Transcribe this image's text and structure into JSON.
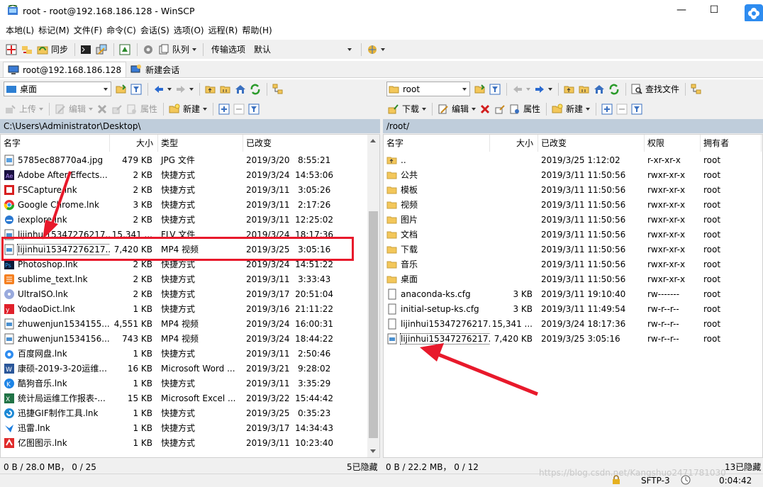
{
  "window": {
    "title": "root - root@192.168.186.128 - WinSCP"
  },
  "menu": [
    "本地(L)",
    "标记(M)",
    "文件(F)",
    "命令(C)",
    "会话(S)",
    "选项(O)",
    "远程(R)",
    "帮助(H)"
  ],
  "toolbar": {
    "sync_label": "同步",
    "queue_label": "队列",
    "transfer_label": "传输选项",
    "transfer_value": "默认"
  },
  "tabs": [
    {
      "label": "root@192.168.186.128"
    },
    {
      "label": "新建会话"
    }
  ],
  "left": {
    "location": "桌面",
    "upload_label": "上传",
    "edit_label": "编辑",
    "props_label": "属性",
    "new_label": "新建",
    "path": "C:\\Users\\Administrator\\Desktop\\",
    "columns": [
      "名字",
      "大小",
      "类型",
      "已改变"
    ],
    "files": [
      {
        "name": "5785ec88770a4.jpg",
        "size": "479 KB",
        "type": "JPG 文件",
        "changed": "2019/3/20   8:55:21",
        "icon": "image-file-icon"
      },
      {
        "name": "Adobe After Effects...",
        "size": "2 KB",
        "type": "快捷方式",
        "changed": "2019/3/24  14:53:06",
        "icon": "after-effects-icon"
      },
      {
        "name": "FSCapture.lnk",
        "size": "2 KB",
        "type": "快捷方式",
        "changed": "2019/3/11   3:05:26",
        "icon": "fscapture-icon"
      },
      {
        "name": "Google Chrome.lnk",
        "size": "3 KB",
        "type": "快捷方式",
        "changed": "2019/3/11   2:17:26",
        "icon": "chrome-icon"
      },
      {
        "name": "iexplore.lnk",
        "size": "2 KB",
        "type": "快捷方式",
        "changed": "2019/3/11  12:25:02",
        "icon": "ie-icon"
      },
      {
        "name": "lijinhui15347276217...",
        "size": "15,341 ...",
        "type": "FLV 文件",
        "changed": "2019/3/24  18:17:36",
        "icon": "video-file-icon"
      },
      {
        "name": "lijinhui15347276217...",
        "size": "7,420 KB",
        "type": "MP4 视频",
        "changed": "2019/3/25   3:05:16",
        "icon": "video-file-icon"
      },
      {
        "name": "Photoshop.lnk",
        "size": "2 KB",
        "type": "快捷方式",
        "changed": "2019/3/24  14:51:22",
        "icon": "photoshop-icon"
      },
      {
        "name": "sublime_text.lnk",
        "size": "2 KB",
        "type": "快捷方式",
        "changed": "2019/3/11   3:33:43",
        "icon": "sublime-icon"
      },
      {
        "name": "UltraISO.lnk",
        "size": "2 KB",
        "type": "快捷方式",
        "changed": "2019/3/17  20:51:04",
        "icon": "ultraiso-icon"
      },
      {
        "name": "YodaoDict.lnk",
        "size": "1 KB",
        "type": "快捷方式",
        "changed": "2019/3/16  21:11:22",
        "icon": "youdao-icon"
      },
      {
        "name": "zhuwenjun1534155...",
        "size": "4,551 KB",
        "type": "MP4 视频",
        "changed": "2019/3/24  16:00:31",
        "icon": "video-file-icon"
      },
      {
        "name": "zhuwenjun1534156...",
        "size": "743 KB",
        "type": "MP4 视频",
        "changed": "2019/3/24  18:44:22",
        "icon": "video-file-icon"
      },
      {
        "name": "百度网盘.lnk",
        "size": "1 KB",
        "type": "快捷方式",
        "changed": "2019/3/11   2:50:46",
        "icon": "baidu-netdisk-icon"
      },
      {
        "name": "康硕-2019-3-20运维...",
        "size": "16 KB",
        "type": "Microsoft Word ...",
        "changed": "2019/3/21   9:28:02",
        "icon": "word-icon"
      },
      {
        "name": "酷狗音乐.lnk",
        "size": "1 KB",
        "type": "快捷方式",
        "changed": "2019/3/11   3:35:29",
        "icon": "kugou-icon"
      },
      {
        "name": "统计局运维工作报表-...",
        "size": "15 KB",
        "type": "Microsoft Excel ...",
        "changed": "2019/3/22  15:44:42",
        "icon": "excel-icon"
      },
      {
        "name": "迅捷GIF制作工具.lnk",
        "size": "1 KB",
        "type": "快捷方式",
        "changed": "2019/3/25   0:35:23",
        "icon": "gif-tool-icon"
      },
      {
        "name": "迅雷.lnk",
        "size": "1 KB",
        "type": "快捷方式",
        "changed": "2019/3/17  14:34:43",
        "icon": "thunder-icon"
      },
      {
        "name": "亿图图示.lnk",
        "size": "1 KB",
        "type": "快捷方式",
        "changed": "2019/3/11  10:23:40",
        "icon": "edraw-icon"
      }
    ],
    "status": "0 B / 28.0 MB，  0 / 25",
    "hidden": "5已隐藏"
  },
  "right": {
    "location": "root",
    "find_label": "查找文件",
    "download_label": "下载",
    "edit_label": "编辑",
    "props_label": "属性",
    "new_label": "新建",
    "path": "/root/",
    "columns": [
      "名字",
      "大小",
      "已改变",
      "权限",
      "拥有者"
    ],
    "files": [
      {
        "name": "..",
        "size": "",
        "changed": "2019/3/25 1:12:02",
        "rights": "r-xr-xr-x",
        "owner": "root",
        "icon": "parent-folder-icon"
      },
      {
        "name": "公共",
        "size": "",
        "changed": "2019/3/11 11:50:56",
        "rights": "rwxr-xr-x",
        "owner": "root",
        "icon": "folder-icon"
      },
      {
        "name": "模板",
        "size": "",
        "changed": "2019/3/11 11:50:56",
        "rights": "rwxr-xr-x",
        "owner": "root",
        "icon": "folder-icon"
      },
      {
        "name": "视频",
        "size": "",
        "changed": "2019/3/11 11:50:56",
        "rights": "rwxr-xr-x",
        "owner": "root",
        "icon": "folder-icon"
      },
      {
        "name": "图片",
        "size": "",
        "changed": "2019/3/11 11:50:56",
        "rights": "rwxr-xr-x",
        "owner": "root",
        "icon": "folder-icon"
      },
      {
        "name": "文档",
        "size": "",
        "changed": "2019/3/11 11:50:56",
        "rights": "rwxr-xr-x",
        "owner": "root",
        "icon": "folder-icon"
      },
      {
        "name": "下载",
        "size": "",
        "changed": "2019/3/11 11:50:56",
        "rights": "rwxr-xr-x",
        "owner": "root",
        "icon": "folder-icon"
      },
      {
        "name": "音乐",
        "size": "",
        "changed": "2019/3/11 11:50:56",
        "rights": "rwxr-xr-x",
        "owner": "root",
        "icon": "folder-icon"
      },
      {
        "name": "桌面",
        "size": "",
        "changed": "2019/3/11 11:50:56",
        "rights": "rwxr-xr-x",
        "owner": "root",
        "icon": "folder-icon"
      },
      {
        "name": "anaconda-ks.cfg",
        "size": "3 KB",
        "changed": "2019/3/11 19:10:40",
        "rights": "rw-------",
        "owner": "root",
        "icon": "text-file-icon"
      },
      {
        "name": "initial-setup-ks.cfg",
        "size": "3 KB",
        "changed": "2019/3/11 11:49:54",
        "rights": "rw-r--r--",
        "owner": "root",
        "icon": "text-file-icon"
      },
      {
        "name": "lijinhui15347276217...",
        "size": "15,341 ...",
        "changed": "2019/3/24 18:17:36",
        "rights": "rw-r--r--",
        "owner": "root",
        "icon": "text-file-icon"
      },
      {
        "name": "lijinhui15347276217...",
        "size": "7,420 KB",
        "changed": "2019/3/25 3:05:16",
        "rights": "rw-r--r--",
        "owner": "root",
        "icon": "video-file-icon"
      }
    ],
    "status": "0 B / 22.2 MB，  0 / 12",
    "hidden": "13已隐藏"
  },
  "bottom": {
    "protocol": "SFTP-3",
    "elapsed": "0:04:42"
  },
  "watermark": "https://blog.csdn.net/Kangshuo2471781030",
  "colors": {
    "highlight": "#e8192b",
    "path_bar": "#bfcddb",
    "folder": "#f3c75a"
  }
}
